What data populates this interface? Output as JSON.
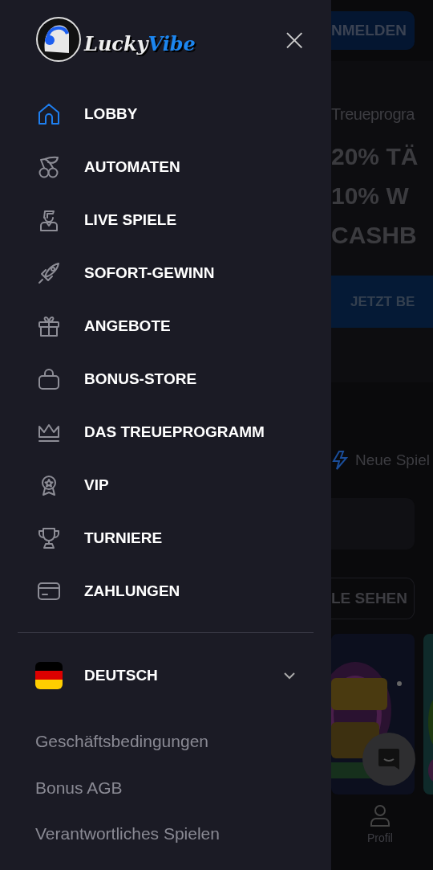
{
  "drawer": {
    "logo": {
      "word_1": "Lucky",
      "word_2": "Vibe"
    },
    "close": "×",
    "menu": [
      {
        "label": "LOBBY",
        "selected": true
      },
      {
        "label": "AUTOMATEN",
        "selected": false
      },
      {
        "label": "LIVE SPIELE",
        "selected": false
      },
      {
        "label": "SOFORT-GEWINN",
        "selected": false
      },
      {
        "label": "ANGEBOTE",
        "selected": false
      },
      {
        "label": "BONUS-STORE",
        "selected": false
      },
      {
        "label": "DAS TREUEPROGRAMM",
        "selected": false
      },
      {
        "label": "VIP",
        "selected": false
      },
      {
        "label": "TURNIERE",
        "selected": false
      },
      {
        "label": "ZAHLUNGEN",
        "selected": false
      }
    ],
    "language": {
      "label": "DEUTSCH",
      "expanded": false
    },
    "links": [
      "Geschäftsbedingungen",
      "Bonus AGB",
      "Verantwortliches Spielen"
    ]
  },
  "background": {
    "login_button": "NMELDEN",
    "promo_subtitle": "Treueprogra",
    "promo_lines": [
      "20% TÄ",
      "10% W",
      "CASHB"
    ],
    "promo_button": "JETZT BE",
    "section_title": "Neue Spiel",
    "see_all_button": "LE SEHEN",
    "bottom_nav": {
      "label": "Profil"
    }
  }
}
